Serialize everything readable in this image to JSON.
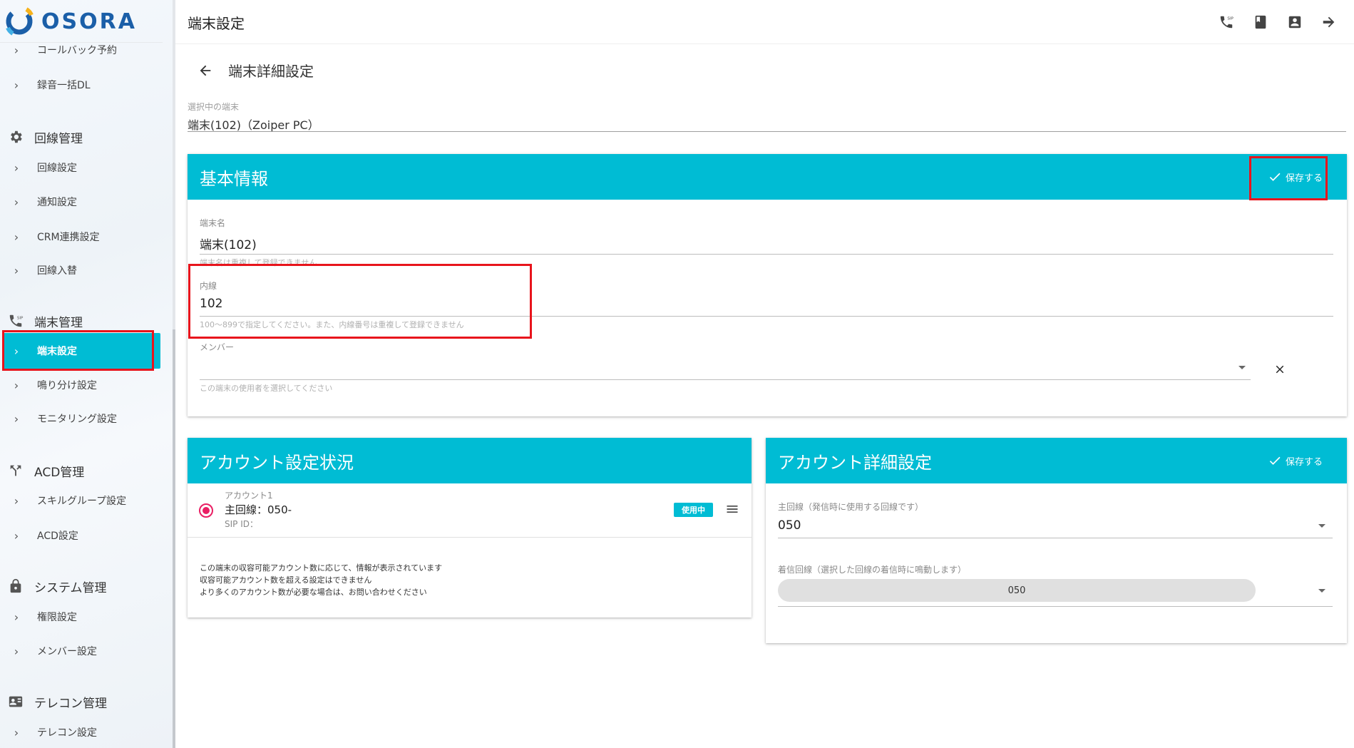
{
  "app": {
    "logo_text": "OSORA",
    "page_title": "端末設定"
  },
  "sidebar": {
    "items_top": [
      {
        "label": "コールバック予約"
      },
      {
        "label": "録音一括DL"
      }
    ],
    "groups": [
      {
        "title": "回線管理",
        "icon": "gear-icon",
        "items": [
          "回線設定",
          "通知設定",
          "CRM連携設定",
          "回線入替"
        ]
      },
      {
        "title": "端末管理",
        "icon": "sip-phone-icon",
        "items": [
          "端末設定",
          "鳴り分け設定",
          "モニタリング設定"
        ]
      },
      {
        "title": "ACD管理",
        "icon": "call-split-icon",
        "items": [
          "スキルグループ設定",
          "ACD設定"
        ]
      },
      {
        "title": "システム管理",
        "icon": "lock-icon",
        "items": [
          "権限設定",
          "メンバー設定"
        ]
      },
      {
        "title": "テレコン管理",
        "icon": "contact-card-icon",
        "items": [
          "テレコン設定"
        ]
      }
    ],
    "active_item": "端末設定"
  },
  "header_icons": [
    "sip-phone-icon",
    "book-icon",
    "contact-icon",
    "logout-arrow-icon"
  ],
  "detail": {
    "back_icon": "arrow-left-icon",
    "title": "端末詳細設定",
    "selected_label": "選択中の端末",
    "selected_value": "端末(102)（Zoiper PC）"
  },
  "basic_info": {
    "title": "基本情報",
    "save_label": "保存する",
    "name_label": "端末名",
    "name_value": "端末(102)",
    "name_hint": "端末名は重複して登録できません",
    "ext_label": "内線",
    "ext_value": "102",
    "ext_hint": "100～899で指定してください。また、内線番号は重複して登録できません",
    "member_label": "メンバー",
    "member_value": "",
    "member_hint": "この端末の使用者を選択してください"
  },
  "account_status": {
    "title": "アカウント設定状況",
    "account_name": "アカウント1",
    "main_line": "主回線：050-",
    "sip_id": "SIP ID：",
    "badge": "使用中",
    "notes": [
      "この端末の収容可能アカウント数に応じて、情報が表示されています",
      "収容可能アカウント数を超える設定はできません",
      "より多くのアカウント数が必要な場合は、お問い合わせください"
    ]
  },
  "account_detail": {
    "title": "アカウント詳細設定",
    "save_label": "保存する",
    "main_line_label": "主回線（発信時に使用する回線です）",
    "main_line_value": "050",
    "incoming_label": "着信回線（選択した回線の着信時に鳴動します）",
    "incoming_chip": "050"
  },
  "colors": {
    "accent": "#00bcd4",
    "highlight": "#e8141c",
    "radio": "#e91e63",
    "logo": "#1b5fa8"
  }
}
